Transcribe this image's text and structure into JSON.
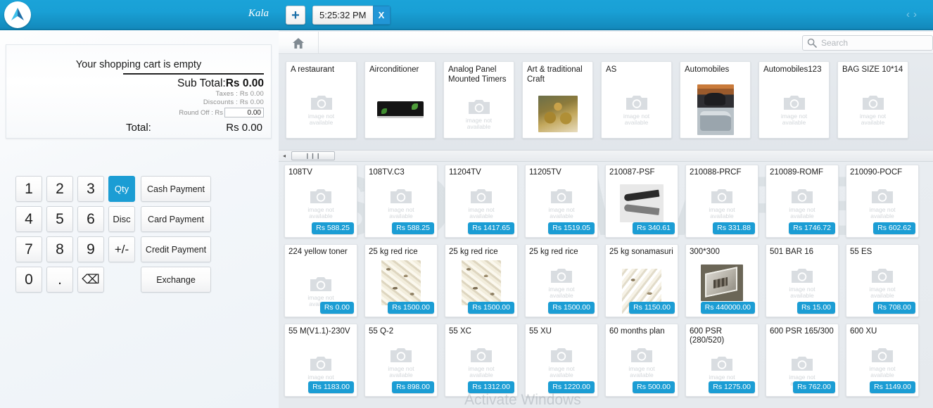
{
  "brand": {
    "name": "Kala",
    "logo_icon": "navigation-arrow-logo"
  },
  "cart": {
    "empty_message": "Your shopping cart is empty",
    "sub_total_label": "Sub Total:",
    "sub_total_value": "Rs 0.00",
    "taxes_line": "Taxes : Rs 0.00",
    "discounts_line": "Discounts : Rs 0.00",
    "round_off_label": "Round Off : Rs",
    "round_off_value": "0.00",
    "total_label": "Total:",
    "total_value": "Rs 0.00"
  },
  "keypad": {
    "rows": [
      [
        {
          "label": "1",
          "type": "digit"
        },
        {
          "label": "2",
          "type": "digit"
        },
        {
          "label": "3",
          "type": "digit"
        },
        {
          "label": "Qty",
          "type": "mode",
          "active": true
        }
      ],
      [
        {
          "label": "4",
          "type": "digit"
        },
        {
          "label": "5",
          "type": "digit"
        },
        {
          "label": "6",
          "type": "digit"
        },
        {
          "label": "Disc",
          "type": "mode",
          "active": false
        }
      ],
      [
        {
          "label": "7",
          "type": "digit"
        },
        {
          "label": "8",
          "type": "digit"
        },
        {
          "label": "9",
          "type": "digit"
        },
        {
          "label": "+/-",
          "type": "sign",
          "active": false
        }
      ],
      [
        {
          "label": "0",
          "type": "digit"
        },
        {
          "label": ".",
          "type": "digit"
        },
        {
          "label": "⌫",
          "type": "backspace"
        },
        {
          "label": "",
          "type": "blank"
        }
      ]
    ],
    "actions": [
      {
        "label": "Cash Payment"
      },
      {
        "label": "Card Payment"
      },
      {
        "label": "Credit Payment"
      },
      {
        "label": "Exchange"
      }
    ]
  },
  "tabbar": {
    "add_tab_label": "+",
    "session_tab_label": "5:25:32 PM",
    "session_tab_close_label": "X",
    "nav_prev_label": "‹",
    "nav_next_label": "›"
  },
  "toolbar": {
    "home_icon": "home-icon",
    "search_placeholder": "Search",
    "search_value": "",
    "search_icon": "search-icon"
  },
  "category_strip": {
    "scroll_left_label": "◂",
    "scroll_thumb_label": "❙❙❙",
    "items": [
      {
        "label": "A restaurant",
        "image": "none"
      },
      {
        "label": "Airconditioner",
        "image": "airconditioner"
      },
      {
        "label": "Analog Panel Mounted Timers",
        "image": "none"
      },
      {
        "label": "Art & traditional Craft",
        "image": "craft"
      },
      {
        "label": "AS",
        "image": "none"
      },
      {
        "label": "Automobiles",
        "image": "automobile"
      },
      {
        "label": "Automobiles123",
        "image": "none"
      },
      {
        "label": "BAG SIZE 10*14",
        "image": "none"
      }
    ]
  },
  "products": {
    "no_image_caption_line1": "image not",
    "no_image_caption_line2": "available",
    "items": [
      {
        "name": "108TV",
        "price": "Rs 588.25",
        "image": "none"
      },
      {
        "name": "108TV.C3",
        "price": "Rs 588.25",
        "image": "none"
      },
      {
        "name": "11204TV",
        "price": "Rs 1417.65",
        "image": "none"
      },
      {
        "name": "11205TV",
        "price": "Rs 1519.05",
        "image": "none"
      },
      {
        "name": "210087-PSF",
        "price": "Rs 340.61",
        "image": "lever"
      },
      {
        "name": "210088-PRCF",
        "price": "Rs 331.88",
        "image": "none"
      },
      {
        "name": "210089-ROMF",
        "price": "Rs 1746.72",
        "image": "none"
      },
      {
        "name": "210090-POCF",
        "price": "Rs 602.62",
        "image": "none"
      },
      {
        "name": "224 yellow toner",
        "price": "Rs 0.00",
        "image": "none"
      },
      {
        "name": "25 kg red rice",
        "price": "Rs 1500.00",
        "image": "rice"
      },
      {
        "name": "25 kg red rice",
        "price": "Rs 1500.00",
        "image": "rice"
      },
      {
        "name": "25 kg red rice",
        "price": "Rs 1500.00",
        "image": "none"
      },
      {
        "name": "25 kg sonamasuri",
        "price": "Rs 1150.00",
        "image": "rice2"
      },
      {
        "name": "300*300",
        "price": "Rs 440000.00",
        "image": "room"
      },
      {
        "name": "501 BAR 16",
        "price": "Rs 15.00",
        "image": "none"
      },
      {
        "name": "55 ES",
        "price": "Rs 708.00",
        "image": "none"
      },
      {
        "name": "55 M(V1.1)-230V",
        "price": "Rs 1183.00",
        "image": "none"
      },
      {
        "name": "55 Q-2",
        "price": "Rs 898.00",
        "image": "none"
      },
      {
        "name": "55 XC",
        "price": "Rs 1312.00",
        "image": "none"
      },
      {
        "name": "55 XU",
        "price": "Rs 1220.00",
        "image": "none"
      },
      {
        "name": "60 months plan",
        "price": "Rs 500.00",
        "image": "none"
      },
      {
        "name": "600 PSR (280/520)",
        "price": "Rs 1275.00",
        "image": "none"
      },
      {
        "name": "600 PSR 165/300",
        "price": "Rs 762.00",
        "image": "none"
      },
      {
        "name": "600 XU",
        "price": "Rs 1149.00",
        "image": "none"
      }
    ]
  },
  "watermarks": {
    "background_text": "SOFTWARE",
    "activate_windows": "Activate Windows"
  },
  "colors": {
    "brand_blue": "#1ba3d8",
    "brand_blue_dark": "#1389bb",
    "accent_badge": "#1b9dd4",
    "panel_bg": "#e9edf1"
  }
}
